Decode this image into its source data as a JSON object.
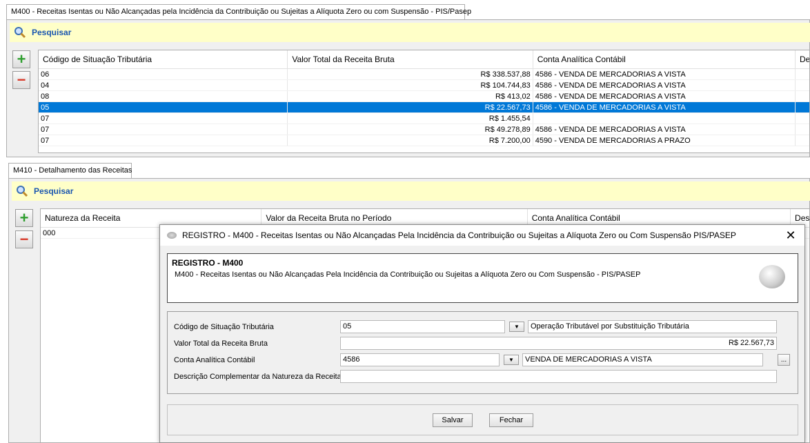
{
  "m400": {
    "tab_label": "M400 - Receitas Isentas ou Não Alcançadas pela Incidência da Contribuição ou Sujeitas a Alíquota Zero ou com Suspensão - PIS/Pasep",
    "search_label": "Pesquisar",
    "add_symbol": "+",
    "remove_symbol": "−",
    "columns": [
      "Código de Situação Tributária",
      "Valor Total da Receita Bruta",
      "Conta Analítica Contábil",
      "De"
    ],
    "rows": [
      {
        "cst": "06",
        "valor": "R$ 338.537,88",
        "conta": "4586 - VENDA DE MERCADORIAS A VISTA",
        "selected": false
      },
      {
        "cst": "04",
        "valor": "R$ 104.744,83",
        "conta": "4586 - VENDA DE MERCADORIAS A VISTA",
        "selected": false
      },
      {
        "cst": "08",
        "valor": "R$ 413,02",
        "conta": "4586 - VENDA DE MERCADORIAS A VISTA",
        "selected": false
      },
      {
        "cst": "05",
        "valor": "R$ 22.567,73",
        "conta": "4586 - VENDA DE MERCADORIAS A VISTA",
        "selected": true
      },
      {
        "cst": "07",
        "valor": "R$ 1.455,54",
        "conta": "",
        "selected": false
      },
      {
        "cst": "07",
        "valor": "R$ 49.278,89",
        "conta": "4586 - VENDA DE MERCADORIAS A VISTA",
        "selected": false
      },
      {
        "cst": "07",
        "valor": "R$ 7.200,00",
        "conta": "4590 - VENDA DE MERCADORIAS A PRAZO",
        "selected": false
      }
    ]
  },
  "m410": {
    "tab_label": "M410 - Detalhamento das Receitas",
    "search_label": "Pesquisar",
    "add_symbol": "+",
    "remove_symbol": "−",
    "columns": [
      "Natureza da Receita",
      "Valor da Receita Bruta no Período",
      "Conta Analítica Contábil",
      "Des"
    ],
    "rows": [
      {
        "natureza": "000"
      }
    ]
  },
  "dialog": {
    "title": "REGISTRO - M400 - Receitas Isentas ou Não Alcançadas Pela Incidência da Contribuição ou Sujeitas a Alíquota Zero ou Com Suspensão  PIS/PASEP",
    "close_symbol": "✕",
    "header_title": "REGISTRO - M400",
    "header_subtitle": "M400 - Receitas Isentas ou Não Alcançadas Pela Incidência da Contribuição ou Sujeitas a Alíquota Zero ou Com Suspensão - PIS/PASEP",
    "fields": {
      "cst_label": "Código de Situação Tributária",
      "cst_value": "05",
      "cst_desc": "Operação Tributável por Substituição Tributária",
      "valor_label": "Valor Total da Receita Bruta",
      "valor_value": "R$ 22.567,73",
      "conta_label": "Conta Analítica Contábil",
      "conta_value": "4586",
      "conta_desc": "VENDA DE MERCADORIAS A VISTA",
      "descricao_label": "Descrição Complementar da Natureza da Receita",
      "descricao_value": "",
      "dropdown_symbol": "▼",
      "lookup_symbol": "..."
    },
    "buttons": {
      "save": "Salvar",
      "close": "Fechar"
    }
  },
  "colors": {
    "search_bg": "#ffffc8",
    "search_text": "#1a56b0",
    "selection": "#0078d7"
  }
}
